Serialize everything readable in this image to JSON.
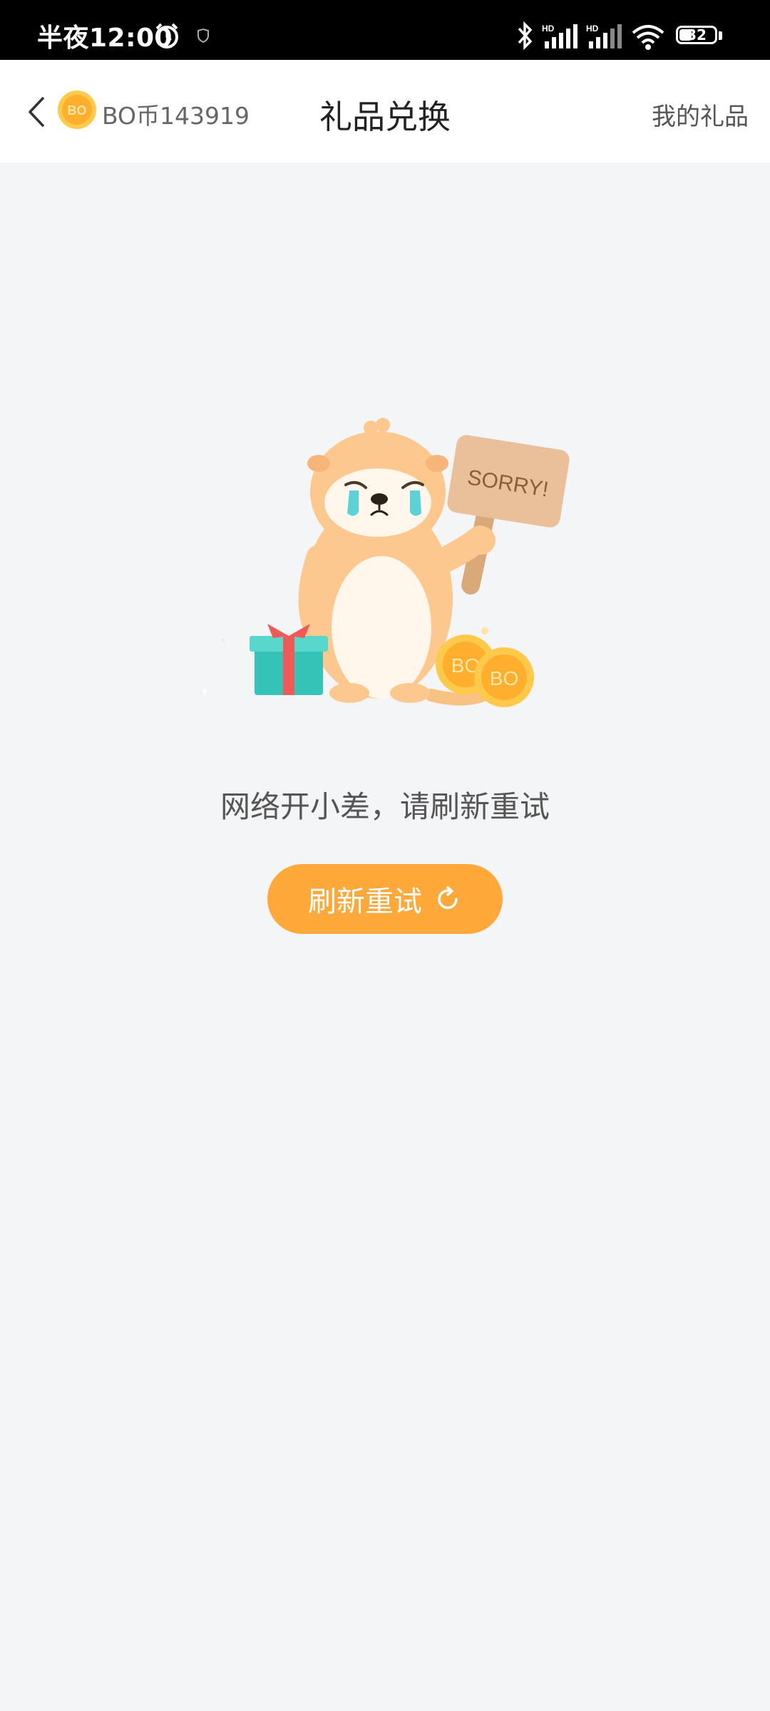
{
  "status_bar": {
    "time": "半夜12:00",
    "battery": "32",
    "icons": [
      "alarm-icon",
      "shield-icon",
      "bluetooth-icon",
      "signal-icon",
      "signal-icon",
      "wifi-icon",
      "battery-icon"
    ],
    "signal_labels": [
      "HD",
      "HD"
    ]
  },
  "header": {
    "coin_icon_label": "BO",
    "coin_text": "BO币143919",
    "title": "礼品兑换",
    "my_gifts": "我的礼品"
  },
  "illustration": {
    "sign_text": "SORRY!",
    "coin_label": "BO"
  },
  "error": {
    "message": "网络开小差，请刷新重试",
    "retry_label": "刷新重试"
  },
  "colors": {
    "accent": "#ffa93b",
    "background": "#f4f5f7"
  }
}
